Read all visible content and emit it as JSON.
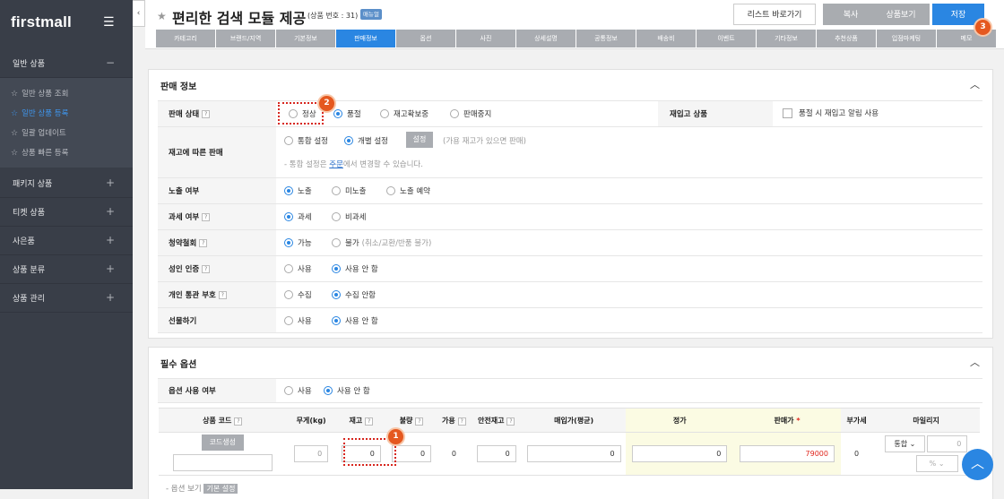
{
  "sidebar": {
    "logo": "firstmall",
    "menu_icon": "hamburger-icon",
    "sections": [
      {
        "label": "일반 상품",
        "sign": "−"
      },
      {
        "label": "패키지 상품",
        "sign": "+"
      },
      {
        "label": "티켓 상품",
        "sign": "+"
      },
      {
        "label": "사은품",
        "sign": "+"
      },
      {
        "label": "상품 분류",
        "sign": "+"
      },
      {
        "label": "상품 관리",
        "sign": "+"
      }
    ],
    "sub_items": [
      {
        "label": "일반 상품 조회"
      },
      {
        "label": "일반 상품 등록"
      },
      {
        "label": "일괄 업데이트"
      },
      {
        "label": "상품 빠른 등록"
      }
    ]
  },
  "header": {
    "title": "편리한 검색 모듈 제공",
    "product_no": "(상품 번호 : 31)",
    "tag": "매뉴얼",
    "buttons": {
      "list": "리스트 바로가기",
      "copy": "복사",
      "view": "상품보기",
      "save": "저장"
    },
    "tabs": [
      "카테고리",
      "브랜드/지역",
      "기본정보",
      "판매정보",
      "옵션",
      "사진",
      "상세설명",
      "공통정보",
      "배송비",
      "이벤트",
      "기타정보",
      "추천상품",
      "입점마케팅",
      "메모"
    ]
  },
  "badges": {
    "b1": "1",
    "b2": "2",
    "b3": "3"
  },
  "sales": {
    "title": "판매 정보",
    "status": {
      "label": "판매 상태",
      "options": [
        "정상",
        "품절",
        "재고확보중",
        "판매중지"
      ]
    },
    "restock": {
      "label": "재입고 상품",
      "checkbox": "품절 시 재입고 알림 사용"
    },
    "stock_sale": {
      "label": "재고에 따른 판매",
      "options": [
        "통합 설정",
        "개별 설정"
      ],
      "btn": "설정",
      "hint": "(가용 재고가 있으면 판매)",
      "note_pre": "- 통합 설정은 ",
      "note_link": "주문",
      "note_post": "에서 변경할 수 있습니다."
    },
    "exposure": {
      "label": "노출 여부",
      "options": [
        "노출",
        "미노출",
        "노출 예약"
      ]
    },
    "tax": {
      "label": "과세 여부",
      "options": [
        "과세",
        "비과세"
      ]
    },
    "withdraw": {
      "label": "청약철회",
      "options": [
        "가능",
        "불가"
      ],
      "hint": "(취소/교환/반품 불가)"
    },
    "adult": {
      "label": "성인 인증",
      "options": [
        "사용",
        "사용 안 함"
      ]
    },
    "customs": {
      "label": "개인 통관 부호",
      "options": [
        "수집",
        "수집 안함"
      ]
    },
    "gift": {
      "label": "선물하기",
      "options": [
        "사용",
        "사용 안 함"
      ]
    }
  },
  "options": {
    "title": "필수 옵션",
    "use": {
      "label": "옵션 사용 여부",
      "options": [
        "사용",
        "사용 안 함"
      ]
    },
    "columns": [
      "상품 코드",
      "무게(kg)",
      "재고",
      "불량",
      "가용",
      "안전재고",
      "매입가(평균)",
      "정가",
      "판매가",
      "부가세",
      "마일리지"
    ],
    "required_mark": "*",
    "code_btn": "코드생성",
    "weight": "0",
    "stock": "0",
    "defect": "0",
    "available": "0",
    "safety": "0",
    "purchase": "0",
    "list_price": "0",
    "sale_price": "79000",
    "vat": "0",
    "mileage_select": "통합",
    "mileage_value": "0",
    "mileage_unit": "%",
    "footer_prefix": "- 옵션 보기",
    "footer_btn": "기본 설정"
  }
}
